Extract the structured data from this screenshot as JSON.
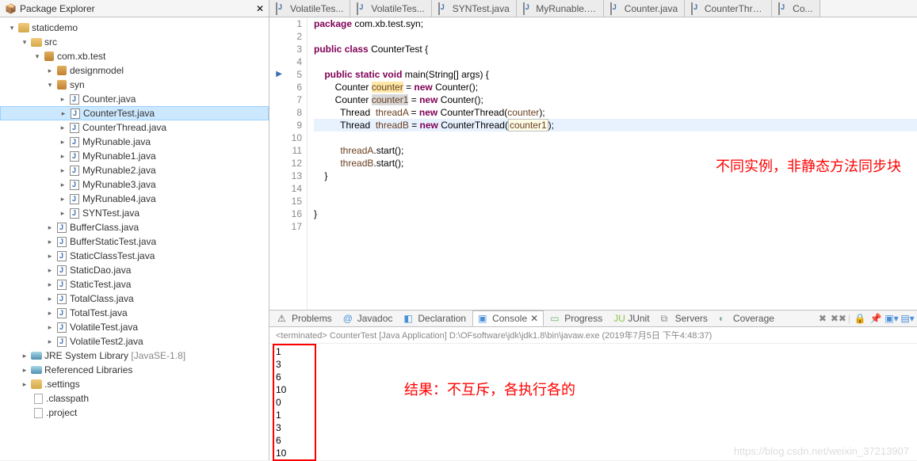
{
  "explorer": {
    "title": "Package Explorer",
    "tree": {
      "project": "staticdemo",
      "src": "src",
      "pkg": "com.xb.test",
      "designmodel": "designmodel",
      "syn": "syn",
      "syn_files": [
        "Counter.java",
        "CounterTest.java",
        "CounterThread.java",
        "MyRunable.java",
        "MyRunable1.java",
        "MyRunable2.java",
        "MyRunable3.java",
        "MyRunable4.java",
        "SYNTest.java"
      ],
      "test_files": [
        "BufferClass.java",
        "BufferStaticTest.java",
        "StaticClassTest.java",
        "StaticDao.java",
        "StaticTest.java",
        "TotalClass.java",
        "TotalTest.java",
        "VolatileTest.java",
        "VolatileTest2.java"
      ],
      "jre": "JRE System Library",
      "jre_dec": "[JavaSE-1.8]",
      "reflib": "Referenced Libraries",
      "settings": ".settings",
      "classpath": ".classpath",
      "projectfile": ".project"
    }
  },
  "editor_tabs": [
    "VolatileTes...",
    "VolatileTes...",
    "SYNTest.java",
    "MyRunable.java",
    "Counter.java",
    "CounterThrea...",
    "Co..."
  ],
  "code": {
    "line1": {
      "kw": "package",
      "rest": " com.xb.test.syn;"
    },
    "line3": {
      "kw1": "public",
      "kw2": "class",
      "name": "CounterTest",
      "brace": " {"
    },
    "line5": {
      "kw1": "public",
      "kw2": "static",
      "kw3": "void",
      "name": "main",
      "args": "(String[] args) {"
    },
    "line6": {
      "type": "Counter ",
      "var": "counter",
      "eq": " = ",
      "kw": "new",
      "call": " Counter();"
    },
    "line7": {
      "type": "Counter ",
      "var": "counter1",
      "eq": " = ",
      "kw": "new",
      "call": " Counter();"
    },
    "line8": {
      "type": "Thread  ",
      "var": "threadA",
      "eq": " = ",
      "kw": "new",
      "call": " CounterThread(",
      "arg": "counter",
      "end": ");"
    },
    "line9": {
      "type": "Thread  ",
      "var": "threadB",
      "eq": " = ",
      "kw": "new",
      "call": " CounterThread(",
      "arg": "counter1",
      "end": ");"
    },
    "line11": {
      "var": "threadA",
      "call": ".start();"
    },
    "line12": {
      "var": "threadB",
      "call": ".start();"
    },
    "line13": "    }",
    "line14": "",
    "line15": "",
    "line16": "}",
    "annotation": "不同实例，非静态方法同步块"
  },
  "line_numbers": [
    "1",
    "2",
    "3",
    "4",
    "5",
    "6",
    "7",
    "8",
    "9",
    "10",
    "11",
    "12",
    "13",
    "14",
    "15",
    "16",
    "17"
  ],
  "bottom": {
    "tabs": {
      "problems": "Problems",
      "javadoc": "Javadoc",
      "declaration": "Declaration",
      "console": "Console",
      "progress": "Progress",
      "junit": "JUnit",
      "servers": "Servers",
      "coverage": "Coverage"
    },
    "console_header": "<terminated> CounterTest [Java Application] D:\\OFsoftware\\jdk\\jdk1.8\\bin\\javaw.exe (2019年7月5日 下午4:48:37)",
    "output": [
      "1",
      "3",
      "6",
      "10",
      "0",
      "1",
      "3",
      "6",
      "10"
    ],
    "result_text": "结果：不互斥，各执行各的",
    "watermark": "https://blog.csdn.net/weixin_37213907"
  }
}
